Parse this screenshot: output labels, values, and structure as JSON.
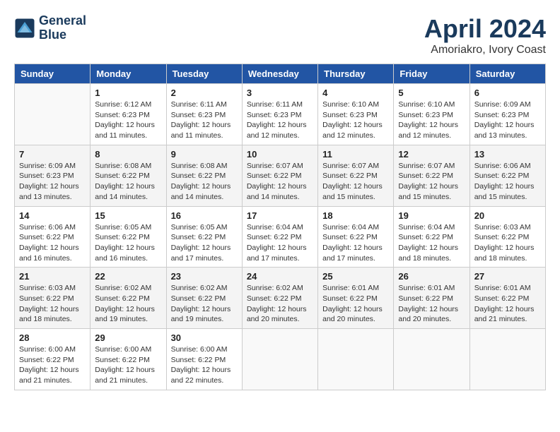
{
  "header": {
    "logo_line1": "General",
    "logo_line2": "Blue",
    "month": "April 2024",
    "location": "Amoriakro, Ivory Coast"
  },
  "weekdays": [
    "Sunday",
    "Monday",
    "Tuesday",
    "Wednesday",
    "Thursday",
    "Friday",
    "Saturday"
  ],
  "weeks": [
    [
      {
        "day": "",
        "info": ""
      },
      {
        "day": "1",
        "info": "Sunrise: 6:12 AM\nSunset: 6:23 PM\nDaylight: 12 hours\nand 11 minutes."
      },
      {
        "day": "2",
        "info": "Sunrise: 6:11 AM\nSunset: 6:23 PM\nDaylight: 12 hours\nand 11 minutes."
      },
      {
        "day": "3",
        "info": "Sunrise: 6:11 AM\nSunset: 6:23 PM\nDaylight: 12 hours\nand 12 minutes."
      },
      {
        "day": "4",
        "info": "Sunrise: 6:10 AM\nSunset: 6:23 PM\nDaylight: 12 hours\nand 12 minutes."
      },
      {
        "day": "5",
        "info": "Sunrise: 6:10 AM\nSunset: 6:23 PM\nDaylight: 12 hours\nand 12 minutes."
      },
      {
        "day": "6",
        "info": "Sunrise: 6:09 AM\nSunset: 6:23 PM\nDaylight: 12 hours\nand 13 minutes."
      }
    ],
    [
      {
        "day": "7",
        "info": "Sunrise: 6:09 AM\nSunset: 6:23 PM\nDaylight: 12 hours\nand 13 minutes."
      },
      {
        "day": "8",
        "info": "Sunrise: 6:08 AM\nSunset: 6:22 PM\nDaylight: 12 hours\nand 14 minutes."
      },
      {
        "day": "9",
        "info": "Sunrise: 6:08 AM\nSunset: 6:22 PM\nDaylight: 12 hours\nand 14 minutes."
      },
      {
        "day": "10",
        "info": "Sunrise: 6:07 AM\nSunset: 6:22 PM\nDaylight: 12 hours\nand 14 minutes."
      },
      {
        "day": "11",
        "info": "Sunrise: 6:07 AM\nSunset: 6:22 PM\nDaylight: 12 hours\nand 15 minutes."
      },
      {
        "day": "12",
        "info": "Sunrise: 6:07 AM\nSunset: 6:22 PM\nDaylight: 12 hours\nand 15 minutes."
      },
      {
        "day": "13",
        "info": "Sunrise: 6:06 AM\nSunset: 6:22 PM\nDaylight: 12 hours\nand 15 minutes."
      }
    ],
    [
      {
        "day": "14",
        "info": "Sunrise: 6:06 AM\nSunset: 6:22 PM\nDaylight: 12 hours\nand 16 minutes."
      },
      {
        "day": "15",
        "info": "Sunrise: 6:05 AM\nSunset: 6:22 PM\nDaylight: 12 hours\nand 16 minutes."
      },
      {
        "day": "16",
        "info": "Sunrise: 6:05 AM\nSunset: 6:22 PM\nDaylight: 12 hours\nand 17 minutes."
      },
      {
        "day": "17",
        "info": "Sunrise: 6:04 AM\nSunset: 6:22 PM\nDaylight: 12 hours\nand 17 minutes."
      },
      {
        "day": "18",
        "info": "Sunrise: 6:04 AM\nSunset: 6:22 PM\nDaylight: 12 hours\nand 17 minutes."
      },
      {
        "day": "19",
        "info": "Sunrise: 6:04 AM\nSunset: 6:22 PM\nDaylight: 12 hours\nand 18 minutes."
      },
      {
        "day": "20",
        "info": "Sunrise: 6:03 AM\nSunset: 6:22 PM\nDaylight: 12 hours\nand 18 minutes."
      }
    ],
    [
      {
        "day": "21",
        "info": "Sunrise: 6:03 AM\nSunset: 6:22 PM\nDaylight: 12 hours\nand 18 minutes."
      },
      {
        "day": "22",
        "info": "Sunrise: 6:02 AM\nSunset: 6:22 PM\nDaylight: 12 hours\nand 19 minutes."
      },
      {
        "day": "23",
        "info": "Sunrise: 6:02 AM\nSunset: 6:22 PM\nDaylight: 12 hours\nand 19 minutes."
      },
      {
        "day": "24",
        "info": "Sunrise: 6:02 AM\nSunset: 6:22 PM\nDaylight: 12 hours\nand 20 minutes."
      },
      {
        "day": "25",
        "info": "Sunrise: 6:01 AM\nSunset: 6:22 PM\nDaylight: 12 hours\nand 20 minutes."
      },
      {
        "day": "26",
        "info": "Sunrise: 6:01 AM\nSunset: 6:22 PM\nDaylight: 12 hours\nand 20 minutes."
      },
      {
        "day": "27",
        "info": "Sunrise: 6:01 AM\nSunset: 6:22 PM\nDaylight: 12 hours\nand 21 minutes."
      }
    ],
    [
      {
        "day": "28",
        "info": "Sunrise: 6:00 AM\nSunset: 6:22 PM\nDaylight: 12 hours\nand 21 minutes."
      },
      {
        "day": "29",
        "info": "Sunrise: 6:00 AM\nSunset: 6:22 PM\nDaylight: 12 hours\nand 21 minutes."
      },
      {
        "day": "30",
        "info": "Sunrise: 6:00 AM\nSunset: 6:22 PM\nDaylight: 12 hours\nand 22 minutes."
      },
      {
        "day": "",
        "info": ""
      },
      {
        "day": "",
        "info": ""
      },
      {
        "day": "",
        "info": ""
      },
      {
        "day": "",
        "info": ""
      }
    ]
  ]
}
